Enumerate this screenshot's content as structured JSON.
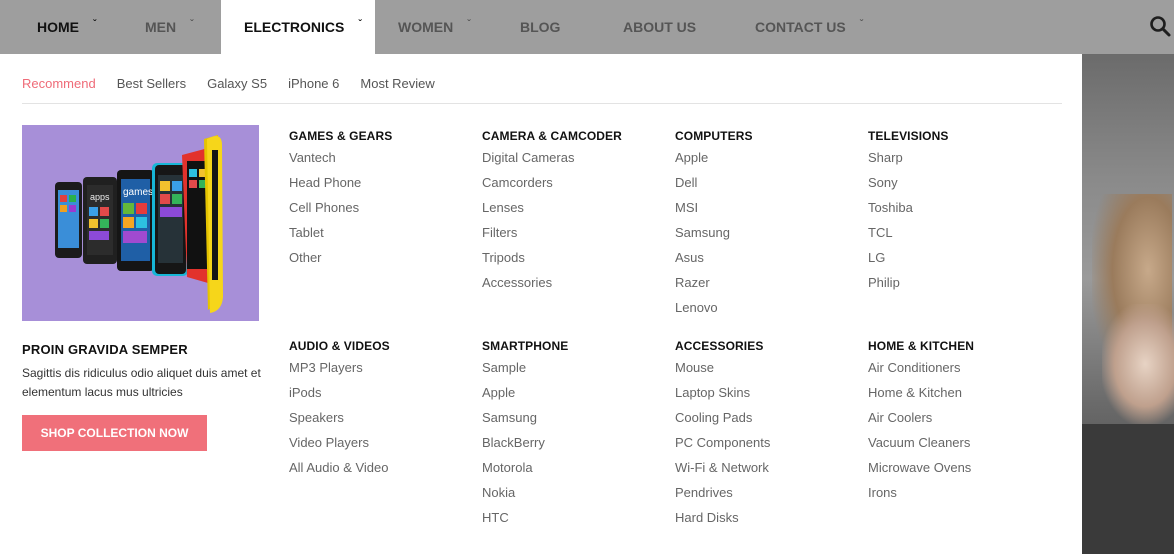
{
  "nav": {
    "items": [
      {
        "label": "HOME",
        "has_dropdown": true
      },
      {
        "label": "MEN",
        "has_dropdown": true
      },
      {
        "label": "ELECTRONICS",
        "has_dropdown": true
      },
      {
        "label": "WOMEN",
        "has_dropdown": true
      },
      {
        "label": "BLOG",
        "has_dropdown": false
      },
      {
        "label": "ABOUT US",
        "has_dropdown": false
      },
      {
        "label": "CONTACT US",
        "has_dropdown": true
      }
    ],
    "active_index": 2,
    "search_icon": "search-icon"
  },
  "mega": {
    "tabs": [
      {
        "label": "Recommend",
        "active": true
      },
      {
        "label": "Best Sellers",
        "active": false
      },
      {
        "label": "Galaxy S5",
        "active": false
      },
      {
        "label": "iPhone 6",
        "active": false
      },
      {
        "label": "Most Review",
        "active": false
      }
    ],
    "promo": {
      "title": "PROIN GRAVIDA SEMPER",
      "text": "Sagittis dis ridiculus odio aliquet duis amet et elementum lacus mus ultricies",
      "button": "SHOP COLLECTION NOW",
      "image_bg": "#a78fd8"
    },
    "columns_row1": [
      {
        "title": "GAMES & GEARS",
        "items": [
          "Vantech",
          "Head Phone",
          "Cell Phones",
          "Tablet",
          "Other"
        ]
      },
      {
        "title": "CAMERA & CAMCODER",
        "items": [
          "Digital Cameras",
          "Camcorders",
          "Lenses",
          "Filters",
          "Tripods",
          "Accessories"
        ]
      },
      {
        "title": "COMPUTERS",
        "items": [
          "Apple",
          "Dell",
          "MSI",
          "Samsung",
          "Asus",
          "Razer",
          "Lenovo"
        ]
      },
      {
        "title": "TELEVISIONS",
        "items": [
          "Sharp",
          "Sony",
          "Toshiba",
          "TCL",
          "LG",
          "Philip"
        ]
      }
    ],
    "columns_row2": [
      {
        "title": "AUDIO & VIDEOS",
        "items": [
          "MP3 Players",
          "iPods",
          "Speakers",
          "Video Players",
          "All Audio & Video"
        ]
      },
      {
        "title": "SMARTPHONE",
        "items": [
          "Sample",
          "Apple",
          "Samsung",
          "BlackBerry",
          "Motorola",
          "Nokia",
          "HTC"
        ]
      },
      {
        "title": "ACCESSORIES",
        "items": [
          "Mouse",
          "Laptop Skins",
          "Cooling Pads",
          "PC Components",
          "Wi-Fi & Network",
          "Pendrives",
          "Hard Disks"
        ]
      },
      {
        "title": "HOME & KITCHEN",
        "items": [
          "Air Conditioners",
          "Home & Kitchen",
          "Air Coolers",
          "Vacuum Cleaners",
          "Microwave Ovens",
          "Irons"
        ]
      }
    ]
  },
  "colors": {
    "accent": "#ef6b78",
    "button": "#f0707a",
    "nav_bg": "#9e9e9e",
    "promo_bg": "#a78fd8"
  }
}
